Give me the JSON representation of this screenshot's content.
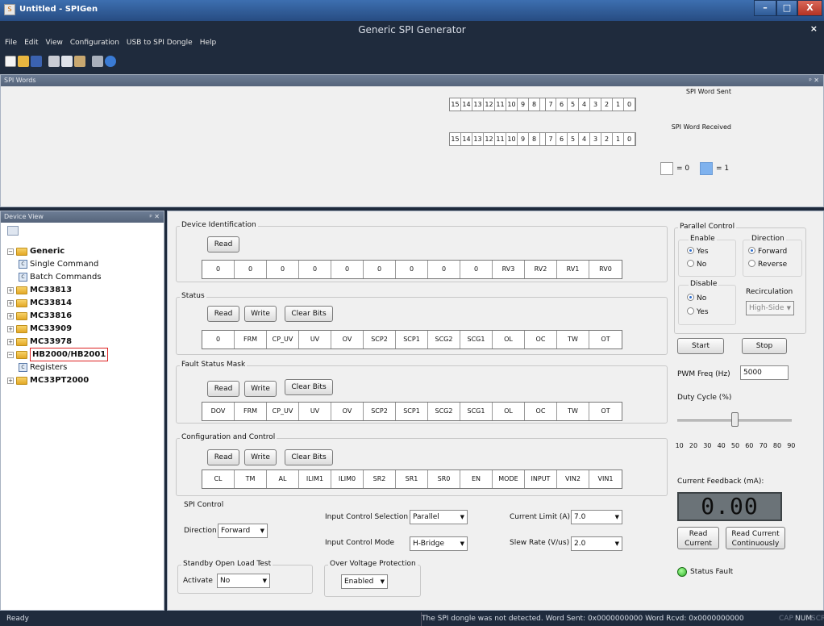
{
  "window": {
    "title": "Untitled - SPIGen",
    "app_title": "Generic SPI Generator",
    "close": "×"
  },
  "window_buttons": [
    "–",
    "□",
    "X"
  ],
  "menu": [
    "File",
    "Edit",
    "View",
    "Configuration",
    "USB to SPI Dongle",
    "Help"
  ],
  "spi_words": {
    "panel_title": "SPI Words",
    "pin": "ᵖ ✕",
    "sent_label": "SPI Word Sent",
    "received_label": "SPI Word Received",
    "bits_high": [
      "15",
      "14",
      "13",
      "12",
      "11",
      "10",
      "9",
      "8"
    ],
    "bits_low": [
      "7",
      "6",
      "5",
      "4",
      "3",
      "2",
      "1",
      "0"
    ],
    "legend_zero": "= 0",
    "legend_one": "= 1"
  },
  "device_view": {
    "panel_title": "Device View",
    "pin": "ᵖ ✕",
    "items": [
      {
        "label": "Generic",
        "level": 0,
        "bold": true,
        "expand": "−"
      },
      {
        "label": "Single Command",
        "level": 1,
        "bold": false
      },
      {
        "label": "Batch Commands",
        "level": 1,
        "bold": false
      },
      {
        "label": "MC33813",
        "level": 0,
        "bold": true,
        "expand": "+"
      },
      {
        "label": "MC33814",
        "level": 0,
        "bold": true,
        "expand": "+"
      },
      {
        "label": "MC33816",
        "level": 0,
        "bold": true,
        "expand": "+"
      },
      {
        "label": "MC33909",
        "level": 0,
        "bold": true,
        "expand": "+"
      },
      {
        "label": "MC33978",
        "level": 0,
        "bold": true,
        "expand": "+"
      },
      {
        "label": "HB2000/HB2001",
        "level": 0,
        "bold": true,
        "expand": "−",
        "highlighted": true
      },
      {
        "label": "Registers",
        "level": 1,
        "bold": false
      },
      {
        "label": "MC33PT2000",
        "level": 0,
        "bold": true,
        "expand": "+"
      }
    ]
  },
  "device_identification": {
    "title": "Device Identification",
    "read": "Read",
    "cells": [
      "0",
      "0",
      "0",
      "0",
      "0",
      "0",
      "0",
      "0",
      "0",
      "RV3",
      "RV2",
      "RV1",
      "RV0"
    ]
  },
  "status_group": {
    "title": "Status",
    "read": "Read",
    "write": "Write",
    "clear": "Clear Bits",
    "cells": [
      "0",
      "FRM",
      "CP_UV",
      "UV",
      "OV",
      "SCP2",
      "SCP1",
      "SCG2",
      "SCG1",
      "OL",
      "OC",
      "TW",
      "OT"
    ]
  },
  "fault_mask": {
    "title": "Fault Status Mask",
    "read": "Read",
    "write": "Write",
    "clear": "Clear Bits",
    "cells": [
      "DOV",
      "FRM",
      "CP_UV",
      "UV",
      "OV",
      "SCP2",
      "SCP1",
      "SCG2",
      "SCG1",
      "OL",
      "OC",
      "TW",
      "OT"
    ]
  },
  "config_control": {
    "title": "Configuration and Control",
    "read": "Read",
    "write": "Write",
    "clear": "Clear Bits",
    "cells": [
      "CL",
      "TM",
      "AL",
      "ILIM1",
      "ILIM0",
      "SR2",
      "SR1",
      "SR0",
      "EN",
      "MODE",
      "INPUT",
      "VIN2",
      "VIN1"
    ]
  },
  "spi_control": {
    "title": "SPI Control",
    "direction_label": "Direction",
    "direction_value": "Forward",
    "input_sel_label": "Input Control Selection",
    "input_sel_value": "Parallel",
    "input_mode_label": "Input Control Mode",
    "input_mode_value": "H-Bridge",
    "current_limit_label": "Current Limit (A)",
    "current_limit_value": "7.0",
    "slew_label": "Slew Rate (V/us)",
    "slew_value": "2.0"
  },
  "standby": {
    "title": "Standby Open Load Test",
    "activate_label": "Activate",
    "activate_value": "No"
  },
  "ovp": {
    "title": "Over Voltage Protection",
    "value": "Enabled"
  },
  "parallel": {
    "title": "Parallel Control",
    "enable_title": "Enable",
    "enable_yes": "Yes",
    "enable_no": "No",
    "direction_title": "Direction",
    "forward": "Forward",
    "reverse": "Reverse",
    "disable_title": "Disable",
    "disable_no": "No",
    "disable_yes": "Yes",
    "recirc_title": "Recirculation",
    "recirc_value": "High-Side",
    "start": "Start",
    "stop": "Stop",
    "pwm_label": "PWM Freq (Hz)",
    "pwm_value": "5000",
    "duty_label": "Duty Cycle (%)",
    "duty_ticks": [
      "10",
      "20",
      "30",
      "40",
      "50",
      "60",
      "70",
      "80",
      "90"
    ],
    "duty_value": 50,
    "current_label": "Current Feedback (mA):",
    "current_value": "0.00",
    "read_current": "Read\nCurrent",
    "read_continuous": "Read Current\nContinuously",
    "status_fault": "Status Fault"
  },
  "statusbar": {
    "left": "Ready",
    "message": "The SPI dongle was not detected. Word Sent: 0x0000000000 Word Rcvd: 0x0000000000",
    "cap": "CAP",
    "num": "NUM",
    "scrl": "SCRL"
  }
}
